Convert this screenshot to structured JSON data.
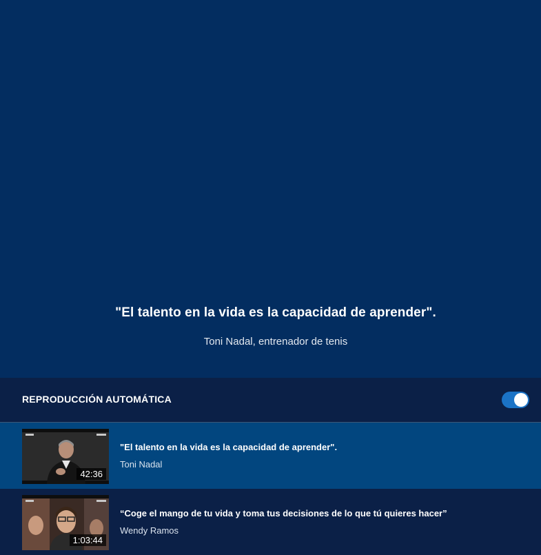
{
  "player": {
    "quote": "\"El talento en la vida es la capacidad de aprender\".",
    "author": "Toni Nadal, entrenador de tenis"
  },
  "autoplay": {
    "label": "REPRODUCCIÓN AUTOMÁTICA",
    "enabled": true
  },
  "playlist": [
    {
      "title": "\"El talento en la vida es la capacidad de aprender\".",
      "author": "Toni Nadal",
      "duration": "42:36",
      "active": true
    },
    {
      "title": "“Coge el mango de tu vida y toma tus decisiones de lo que tú quieres hacer”",
      "author": "Wendy Ramos",
      "duration": "1:03:44",
      "active": false
    }
  ],
  "colors": {
    "player_bg": "#032d60",
    "panel_bg": "#0b2047",
    "active_row": "#02467f",
    "toggle_on": "#1b73c6"
  }
}
